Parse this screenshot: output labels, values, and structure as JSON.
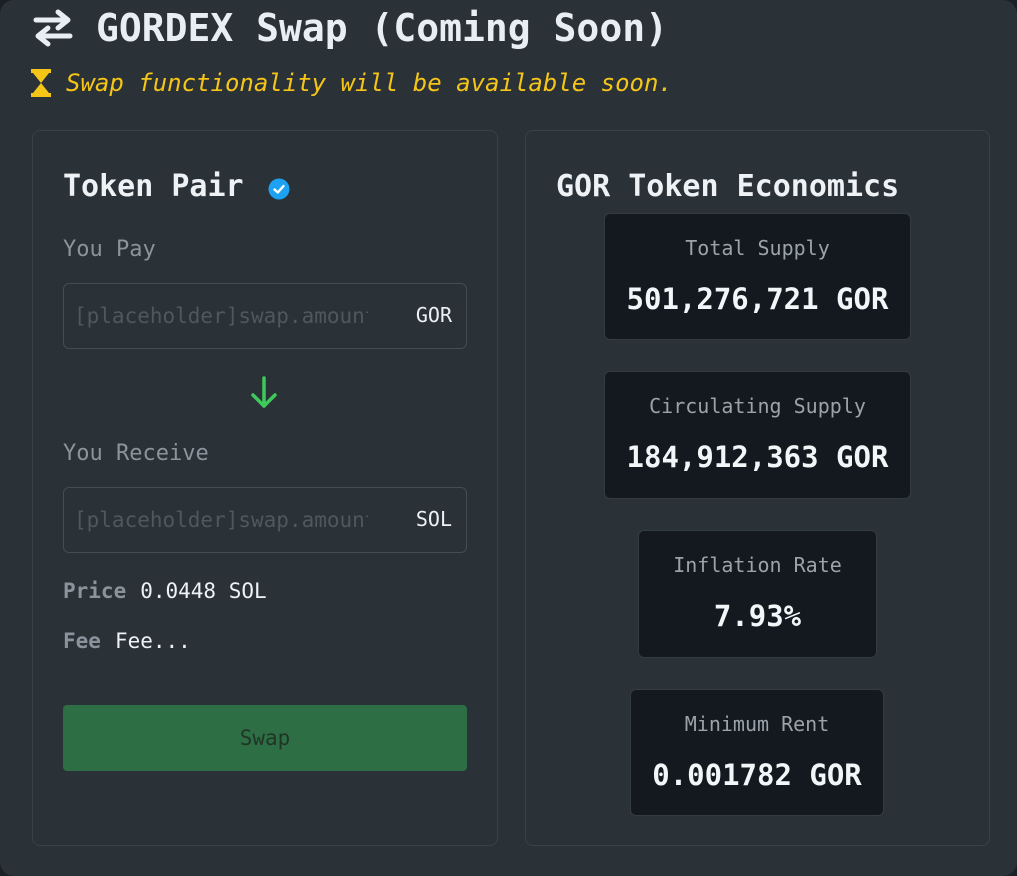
{
  "header": {
    "title": "GORDEX Swap (Coming Soon)",
    "notice": "Swap functionality will be available soon."
  },
  "swap": {
    "title": "Token Pair",
    "pay_label": "You Pay",
    "pay_placeholder": "[placeholder]swap.amount",
    "pay_token": "GOR",
    "receive_label": "You Receive",
    "receive_placeholder": "[placeholder]swap.amount",
    "receive_token": "SOL",
    "price_label": "Price",
    "price_value": "0.0448 SOL",
    "fee_label": "Fee",
    "fee_value": "Fee...",
    "button_label": "Swap"
  },
  "economics": {
    "title": "GOR Token Economics",
    "stats": [
      {
        "label": "Total Supply",
        "value": "501,276,721 GOR"
      },
      {
        "label": "Circulating Supply",
        "value": "184,912,363 GOR"
      },
      {
        "label": "Inflation Rate",
        "value": "7.93%"
      },
      {
        "label": "Minimum Rent",
        "value": "0.001782 GOR"
      }
    ]
  },
  "colors": {
    "background": "#2a3137",
    "stat_card": "#13191e",
    "notice": "#f5c518",
    "arrow": "#3fc95a",
    "verified": "#1da1f2",
    "button": "#2e6e45"
  },
  "icons": {
    "title": "swap-arrows-icon",
    "notice": "hourglass-icon",
    "verified": "verified-badge-icon",
    "direction": "arrow-down-icon"
  }
}
